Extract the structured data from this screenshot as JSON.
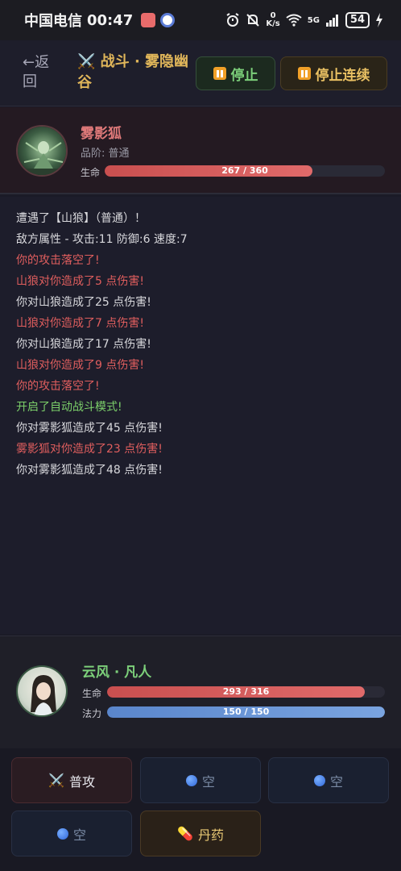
{
  "statusbar": {
    "carrier": "中国电信",
    "time": "00:47",
    "speed_value": "0",
    "speed_unit": "K/s",
    "network": "5G",
    "battery": "54"
  },
  "header": {
    "back_label": "←返回",
    "title": "⚔️ 战斗 · 雾隐幽谷",
    "stop_label": "停止",
    "stop_continuous_label": "停止连续"
  },
  "enemy": {
    "name": "雾影狐",
    "rank": "品阶: 普通",
    "hp_label": "生命",
    "hp_text": "267 / 360",
    "hp_fraction": 0.742
  },
  "log": [
    {
      "text": "遭遇了【山狼】（普通）！",
      "tone": "normal"
    },
    {
      "text": "敌方属性 - 攻击:11 防御:6 速度:7",
      "tone": "normal"
    },
    {
      "text": "你的攻击落空了!",
      "tone": "red"
    },
    {
      "text": "山狼对你造成了5 点伤害!",
      "tone": "red"
    },
    {
      "text": "你对山狼造成了25 点伤害!",
      "tone": "normal"
    },
    {
      "text": "山狼对你造成了7 点伤害!",
      "tone": "red"
    },
    {
      "text": "你对山狼造成了17 点伤害!",
      "tone": "normal"
    },
    {
      "text": "山狼对你造成了9 点伤害!",
      "tone": "red"
    },
    {
      "text": "你的攻击落空了!",
      "tone": "red"
    },
    {
      "text": "开启了自动战斗模式!",
      "tone": "green"
    },
    {
      "text": "你对雾影狐造成了45 点伤害!",
      "tone": "normal"
    },
    {
      "text": "雾影狐对你造成了23 点伤害!",
      "tone": "red"
    },
    {
      "text": "你对雾影狐造成了48 点伤害!",
      "tone": "normal"
    }
  ],
  "player": {
    "name": "云风 · 凡人",
    "hp_label": "生命",
    "hp_text": "293 / 316",
    "hp_fraction": 0.927,
    "mp_label": "法力",
    "mp_text": "150 / 150",
    "mp_fraction": 1.0
  },
  "actions": {
    "attack_label": "普攻",
    "empty_label": "空",
    "pill_label": "丹药"
  },
  "colors": {
    "accent_gold": "#e0b65a",
    "hp_red": "#d45858",
    "mp_blue": "#6b94d4",
    "log_red": "#e05e5e",
    "log_green": "#7ccf6a"
  },
  "icons": [
    "alarm-icon",
    "mute-icon",
    "wifi-icon",
    "signal-icon",
    "battery-icon",
    "charging-icon",
    "swords-icon",
    "pause-icon",
    "orb-icon",
    "pill-icon"
  ]
}
